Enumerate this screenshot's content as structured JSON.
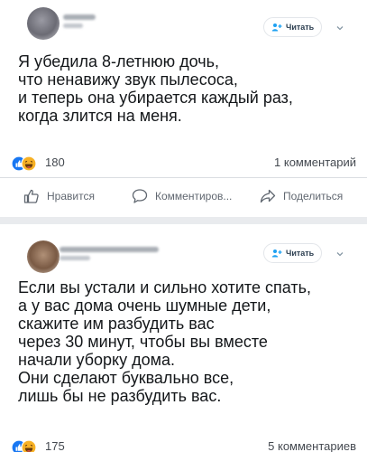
{
  "posts": [
    {
      "follow_label": "Читать",
      "lines": [
        "Я убедила 8-летнюю дочь,",
        "что ненавижу звук пылесоса,",
        "и теперь она убирается каждый раз,",
        "когда злится на меня."
      ],
      "reactions_count": "180",
      "comments_label": "1 комментарий",
      "actions": {
        "like": "Нравится",
        "comment": "Комментиров...",
        "share": "Поделиться"
      }
    },
    {
      "follow_label": "Читать",
      "lines": [
        "Если вы устали и сильно хотите спать,",
        "а у вас дома очень шумные дети,",
        "скажите им разбудить вас",
        "через 30 минут, чтобы вы вместе",
        "начали уборку дома.",
        "Они сделают буквально все,",
        "лишь бы не разбудить вас."
      ],
      "reactions_count": "175",
      "comments_label": "5 комментариев"
    }
  ],
  "colors": {
    "like_blue": "#1877f2",
    "haha_yellow": "#f7b125",
    "page_bg": "#e9ebee"
  },
  "icons": [
    "add-user-icon",
    "chevron-down-icon",
    "like-reaction-icon",
    "haha-reaction-icon",
    "thumbs-up-icon",
    "comment-icon",
    "share-icon"
  ]
}
